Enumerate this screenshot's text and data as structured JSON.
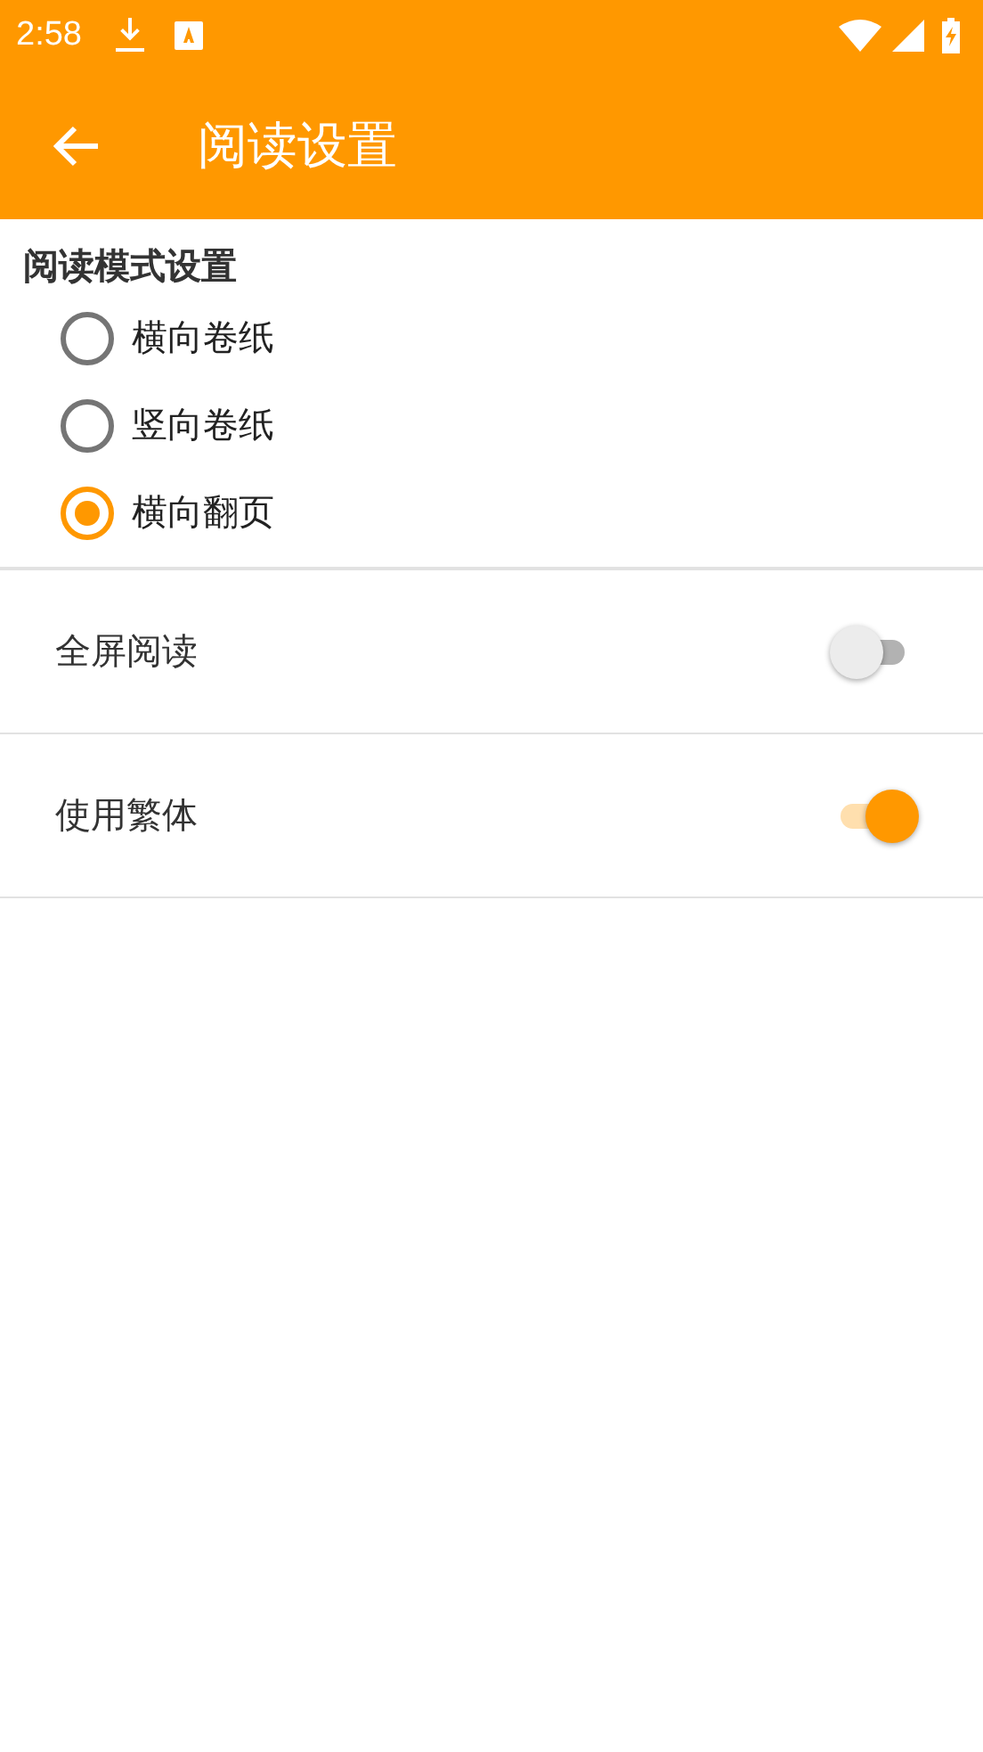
{
  "status_bar": {
    "time": "2:58"
  },
  "app_bar": {
    "title": "阅读设置"
  },
  "reading_mode": {
    "title": "阅读模式设置",
    "options": [
      {
        "label": "横向卷纸",
        "selected": false
      },
      {
        "label": "竖向卷纸",
        "selected": false
      },
      {
        "label": "横向翻页",
        "selected": true
      }
    ]
  },
  "settings": [
    {
      "label": "全屏阅读",
      "on": false
    },
    {
      "label": "使用繁体",
      "on": true
    }
  ]
}
